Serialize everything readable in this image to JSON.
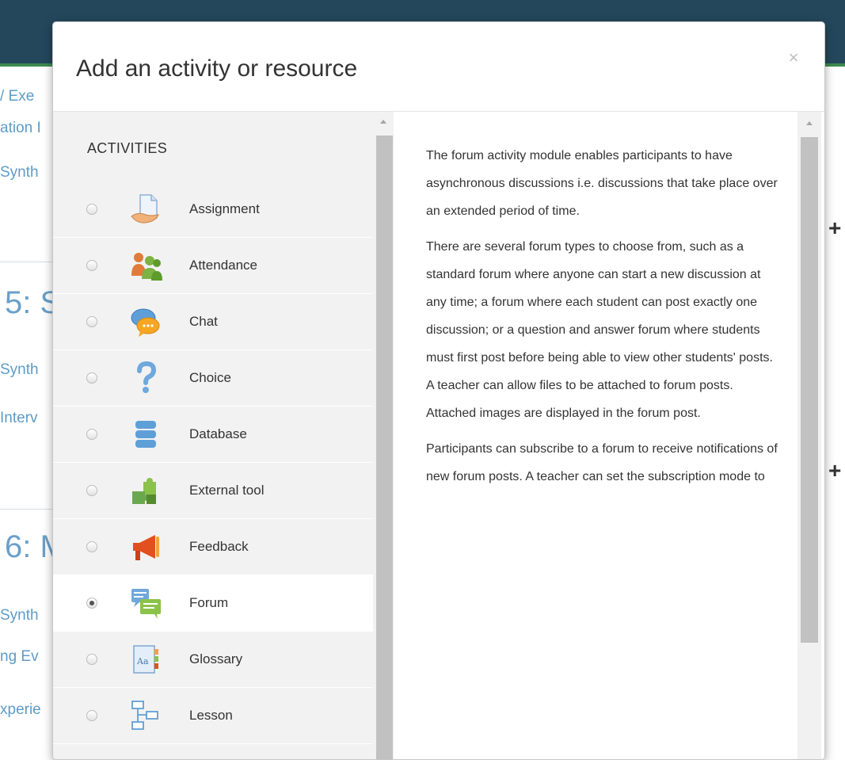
{
  "background": {
    "snippets": [
      "/ Exe",
      "ation I",
      "Synth",
      "Synth",
      "Interv",
      "Synth",
      "ng Ev",
      "xperie"
    ],
    "section_headings": [
      "5: S",
      "6: M"
    ],
    "plus_icons": [
      "+",
      "+"
    ]
  },
  "modal": {
    "title": "Add an activity or resource",
    "close_label": "×",
    "section_title": "ACTIVITIES",
    "activities": [
      {
        "label": "Assignment",
        "icon": "assignment-icon",
        "selected": false
      },
      {
        "label": "Attendance",
        "icon": "attendance-icon",
        "selected": false
      },
      {
        "label": "Chat",
        "icon": "chat-icon",
        "selected": false
      },
      {
        "label": "Choice",
        "icon": "choice-icon",
        "selected": false
      },
      {
        "label": "Database",
        "icon": "database-icon",
        "selected": false
      },
      {
        "label": "External tool",
        "icon": "external-tool-icon",
        "selected": false
      },
      {
        "label": "Feedback",
        "icon": "feedback-icon",
        "selected": false
      },
      {
        "label": "Forum",
        "icon": "forum-icon",
        "selected": true
      },
      {
        "label": "Glossary",
        "icon": "glossary-icon",
        "selected": false
      },
      {
        "label": "Lesson",
        "icon": "lesson-icon",
        "selected": false
      }
    ],
    "description": [
      "The forum activity module enables participants to have asynchronous discussions i.e. discussions that take place over an extended period of time.",
      "There are several forum types to choose from, such as a standard forum where anyone can start a new discussion at any time; a forum where each student can post exactly one discussion; or a question and answer forum where students must first post before being able to view other students' posts. A teacher can allow files to be attached to forum posts. Attached images are displayed in the forum post.",
      "Participants can subscribe to a forum to receive notifications of new forum posts. A teacher can set the subscription mode to"
    ]
  },
  "colors": {
    "topbar": "#24475c",
    "accent_green": "#3c8a50",
    "link_blue": "#5d9cc7",
    "left_pane_bg": "#f2f2f2"
  }
}
